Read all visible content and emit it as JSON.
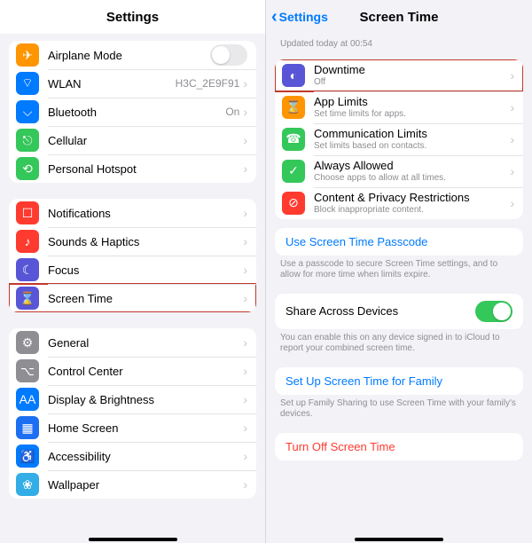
{
  "left": {
    "title": "Settings",
    "groups": [
      {
        "rows": [
          {
            "icon": "airplane-icon",
            "color": "bg-orange",
            "glyph": "✈",
            "label": "Airplane Mode",
            "control": "toggle",
            "on": false
          },
          {
            "icon": "wifi-icon",
            "color": "bg-blue",
            "glyph": "⌔",
            "label": "WLAN",
            "detail": "H3C_2E9F91",
            "chevron": true
          },
          {
            "icon": "bluetooth-icon",
            "color": "bg-blue",
            "glyph": "⌵",
            "label": "Bluetooth",
            "detail": "On",
            "chevron": true
          },
          {
            "icon": "cellular-icon",
            "color": "bg-green",
            "glyph": "⎋",
            "label": "Cellular",
            "chevron": true
          },
          {
            "icon": "hotspot-icon",
            "color": "bg-green",
            "glyph": "⟲",
            "label": "Personal Hotspot",
            "chevron": true
          }
        ]
      },
      {
        "rows": [
          {
            "icon": "notifications-icon",
            "color": "bg-red",
            "glyph": "☐",
            "label": "Notifications",
            "chevron": true
          },
          {
            "icon": "sounds-icon",
            "color": "bg-red",
            "glyph": "♪",
            "label": "Sounds & Haptics",
            "chevron": true
          },
          {
            "icon": "focus-icon",
            "color": "bg-indigo",
            "glyph": "☾",
            "label": "Focus",
            "chevron": true
          },
          {
            "icon": "screentime-icon",
            "color": "bg-indigo",
            "glyph": "⌛",
            "label": "Screen Time",
            "chevron": true,
            "highlight": true
          }
        ]
      },
      {
        "rows": [
          {
            "icon": "general-icon",
            "color": "bg-grey",
            "glyph": "⚙",
            "label": "General",
            "chevron": true
          },
          {
            "icon": "controlcenter-icon",
            "color": "bg-grey",
            "glyph": "⌥",
            "label": "Control Center",
            "chevron": true
          },
          {
            "icon": "display-icon",
            "color": "bg-blue",
            "glyph": "AA",
            "label": "Display & Brightness",
            "chevron": true
          },
          {
            "icon": "homescreen-icon",
            "color": "bg-darkblue",
            "glyph": "▦",
            "label": "Home Screen",
            "chevron": true
          },
          {
            "icon": "accessibility-icon",
            "color": "bg-blue",
            "glyph": "♿",
            "label": "Accessibility",
            "chevron": true
          },
          {
            "icon": "wallpaper-icon",
            "color": "bg-lightblue",
            "glyph": "❀",
            "label": "Wallpaper",
            "chevron": true
          }
        ]
      }
    ]
  },
  "right": {
    "back": "Settings",
    "title": "Screen Time",
    "updated": "Updated today at 00:54",
    "mainRows": [
      {
        "icon": "downtime-icon",
        "color": "bg-indigo",
        "glyph": "◐",
        "label": "Downtime",
        "sublabel": "Off",
        "chevron": true,
        "highlight": true
      },
      {
        "icon": "applimits-icon",
        "color": "bg-orange",
        "glyph": "⌛",
        "label": "App Limits",
        "sublabel": "Set time limits for apps.",
        "chevron": true
      },
      {
        "icon": "commlimits-icon",
        "color": "bg-green",
        "glyph": "☎",
        "label": "Communication Limits",
        "sublabel": "Set limits based on contacts.",
        "chevron": true
      },
      {
        "icon": "alwaysallowed-icon",
        "color": "bg-green",
        "glyph": "✓",
        "label": "Always Allowed",
        "sublabel": "Choose apps to allow at all times.",
        "chevron": true
      },
      {
        "icon": "contentpriv-icon",
        "color": "bg-red",
        "glyph": "⊘",
        "label": "Content & Privacy Restrictions",
        "sublabel": "Block inappropriate content.",
        "chevron": true
      }
    ],
    "passcodeLink": "Use Screen Time Passcode",
    "passcodeCaption": "Use a passcode to secure Screen Time settings, and to allow for more time when limits expire.",
    "shareLabel": "Share Across Devices",
    "shareOn": true,
    "shareCaption": "You can enable this on any device signed in to iCloud to report your combined screen time.",
    "familyLink": "Set Up Screen Time for Family",
    "familyCaption": "Set up Family Sharing to use Screen Time with your family's devices.",
    "turnOffLink": "Turn Off Screen Time"
  }
}
